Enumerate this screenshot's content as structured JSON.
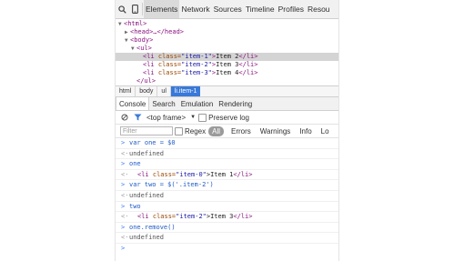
{
  "toolbar": {
    "tabs": [
      "Elements",
      "Network",
      "Sources",
      "Timeline",
      "Profiles",
      "Resou"
    ],
    "active": "Elements"
  },
  "dom": {
    "html_open": "<html>",
    "head": "<head>…</head>",
    "body_open": "<body>",
    "ul_open": "<ul>",
    "li": [
      {
        "open": "<li ",
        "attr": "class=",
        "val": "\"item-1\"",
        "close_tag": ">",
        "text": "Item 2",
        "end": "</li>"
      },
      {
        "open": "<li ",
        "attr": "class=",
        "val": "\"item-2\"",
        "close_tag": ">",
        "text": "Item 3",
        "end": "</li>"
      },
      {
        "open": "<li ",
        "attr": "class=",
        "val": "\"item-3\"",
        "close_tag": ">",
        "text": "Item 4",
        "end": "</li>"
      }
    ],
    "ul_close": "</ul>"
  },
  "breadcrumb": [
    "html",
    "body",
    "ul",
    "li.item-1"
  ],
  "drawer_tabs": [
    "Console",
    "Search",
    "Emulation",
    "Rendering"
  ],
  "console_toolbar": {
    "frame": "<top frame>",
    "preserve_log": "Preserve log"
  },
  "filter_bar": {
    "placeholder": "Filter",
    "regex": "Regex",
    "levels": [
      "All",
      "Errors",
      "Warnings",
      "Info",
      "Lo"
    ]
  },
  "console": {
    "line1_in": "var one = $0",
    "line2_out": "undefined",
    "line3_in": "one",
    "line4_el": {
      "open": "<li ",
      "attr": "class=",
      "val": "\"item-0\"",
      "text": ">Item 1",
      "end": "</li>"
    },
    "line5_in": "var two = $('.item-2')",
    "line6_out": "undefined",
    "line7_in": "two",
    "line8_el": {
      "open": "<li ",
      "attr": "class=",
      "val": "\"item-2\"",
      "text": ">Item 3",
      "end": "</li>"
    },
    "line9_in": "one.remove()",
    "line10_out": "undefined"
  },
  "colors": {
    "tag": "#881280",
    "attr": "#994500",
    "value": "#1a1aa6",
    "accent": "#3879d9"
  }
}
